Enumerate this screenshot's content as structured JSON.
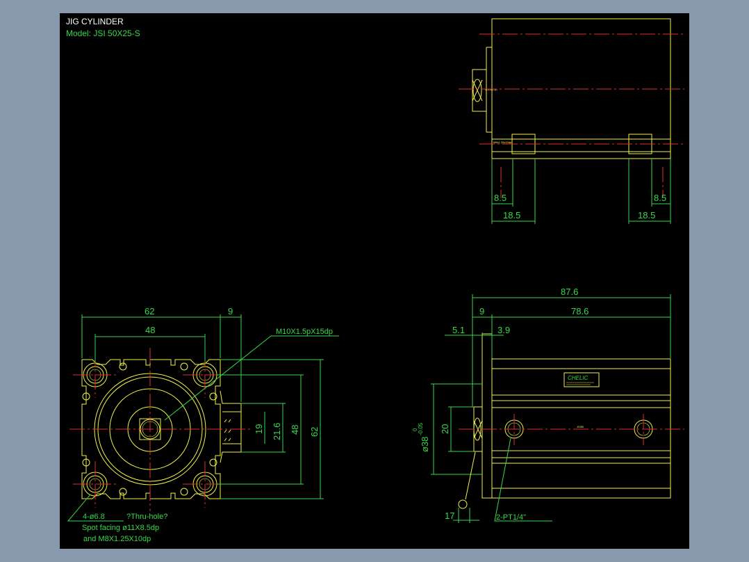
{
  "title": {
    "line1": "JIG CYLINDER",
    "line2": "Model: JSI 50X25-S"
  },
  "dimensions": {
    "front_width": "62",
    "front_offset": "9",
    "front_bolt_pitch": "48",
    "front_side_height_total": "62",
    "front_side_height_bolt": "48",
    "front_side_21_6": "21.6",
    "front_side_19": "19",
    "front_left_8_5": "8.5",
    "front_right_8_5": "8.5",
    "front_left_18_5": "18.5",
    "front_right_18_5": "18.5",
    "side_total": "87.6",
    "side_9": "9",
    "side_78_6": "78.6",
    "side_5_1": "5.1",
    "side_3_9": "3.9",
    "side_20": "20",
    "side_17": "17"
  },
  "callouts": {
    "thread": "M10X1.5pX15dp",
    "holes_1": "4-ø6.8",
    "holes_1b": "?Thru-hole?",
    "holes_2": "Spot facing ø11X8.5dp",
    "holes_3": "and M8X1.25X10dp",
    "bore": "ø38",
    "bore_tol_upper": "0",
    "bore_tol_lower": "-0.05",
    "port": "2-PT1/4\"",
    "brand": "CHELIC"
  },
  "colors": {
    "background": "#000000",
    "outline": "#f2f24a",
    "dimension": "#38d84a",
    "centerline": "#e03030",
    "title_text": "#ffffff",
    "frame": "#8898ad"
  }
}
